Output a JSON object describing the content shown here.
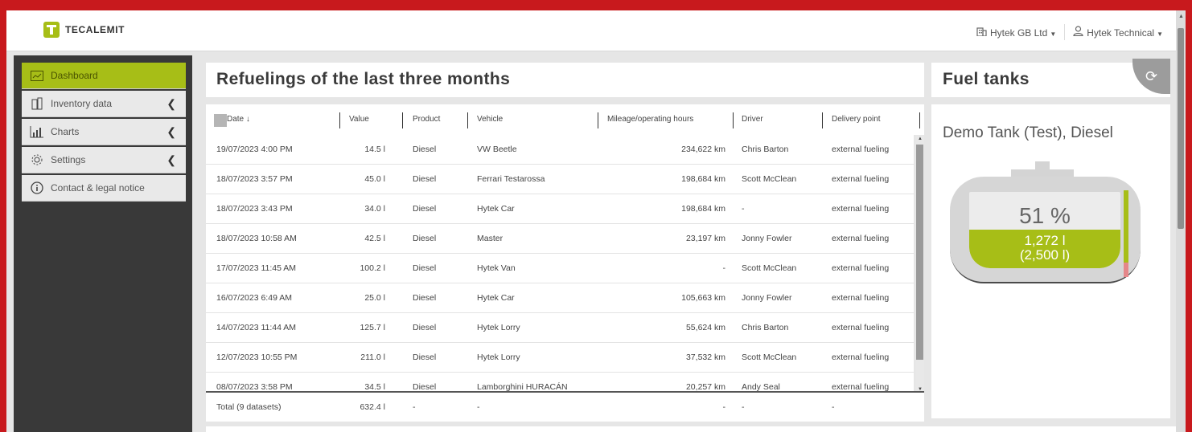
{
  "app": {
    "brand": "TECALEMIT",
    "company_menu": "Hytek GB Ltd",
    "user_menu": "Hytek Technical"
  },
  "sidebar": {
    "items": [
      {
        "label": "Dashboard",
        "icon": "dashboard-icon",
        "active": true
      },
      {
        "label": "Inventory data",
        "icon": "inventory-icon",
        "active": false
      },
      {
        "label": "Charts",
        "icon": "chart-icon",
        "active": false
      },
      {
        "label": "Settings",
        "icon": "gear-icon",
        "active": false
      },
      {
        "label": "Contact & legal notice",
        "icon": "info-icon",
        "active": false
      }
    ]
  },
  "refuelings": {
    "title": "Refuelings of the last three months",
    "columns": [
      "Date",
      "Value",
      "Product",
      "Vehicle",
      "Mileage/operating hours",
      "Driver",
      "Delivery point"
    ],
    "rows": [
      {
        "date": "19/07/2023 4:00 PM",
        "value": "14.5 l",
        "product": "Diesel",
        "vehicle": "VW Beetle",
        "mileage": "234,622 km",
        "driver": "Chris Barton",
        "delivery": "external fueling"
      },
      {
        "date": "18/07/2023 3:57 PM",
        "value": "45.0 l",
        "product": "Diesel",
        "vehicle": "Ferrari Testarossa",
        "mileage": "198,684 km",
        "driver": "Scott McClean",
        "delivery": "external fueling"
      },
      {
        "date": "18/07/2023 3:43 PM",
        "value": "34.0 l",
        "product": "Diesel",
        "vehicle": "Hytek Car",
        "mileage": "198,684 km",
        "driver": "-",
        "delivery": "external fueling"
      },
      {
        "date": "18/07/2023 10:58 AM",
        "value": "42.5 l",
        "product": "Diesel",
        "vehicle": "Master",
        "mileage": "23,197 km",
        "driver": "Jonny Fowler",
        "delivery": "external fueling"
      },
      {
        "date": "17/07/2023 11:45 AM",
        "value": "100.2 l",
        "product": "Diesel",
        "vehicle": "Hytek Van",
        "mileage": "-",
        "driver": "Scott McClean",
        "delivery": "external fueling"
      },
      {
        "date": "16/07/2023 6:49 AM",
        "value": "25.0 l",
        "product": "Diesel",
        "vehicle": "Hytek Car",
        "mileage": "105,663 km",
        "driver": "Jonny Fowler",
        "delivery": "external fueling"
      },
      {
        "date": "14/07/2023 11:44 AM",
        "value": "125.7 l",
        "product": "Diesel",
        "vehicle": "Hytek Lorry",
        "mileage": "55,624 km",
        "driver": "Chris Barton",
        "delivery": "external fueling"
      },
      {
        "date": "12/07/2023 10:55 PM",
        "value": "211.0 l",
        "product": "Diesel",
        "vehicle": "Hytek Lorry",
        "mileage": "37,532 km",
        "driver": "Scott McClean",
        "delivery": "external fueling"
      },
      {
        "date": "08/07/2023 3:58 PM",
        "value": "34.5 l",
        "product": "Diesel",
        "vehicle": "Lamborghini HURACÁN",
        "mileage": "20,257 km",
        "driver": "Andy Seal",
        "delivery": "external fueling"
      }
    ],
    "total": {
      "label": "Total (9 datasets)",
      "value": "632.4 l",
      "product": "-",
      "vehicle": "-",
      "mileage": "-",
      "driver": "-",
      "delivery": "-"
    }
  },
  "fuel_tanks": {
    "title": "Fuel tanks",
    "tank": {
      "name": "Demo Tank (Test), Diesel",
      "percent_label": "51 %",
      "fill_fraction": 0.51,
      "volume": "1,272 l",
      "capacity": "(2,500 l)"
    }
  },
  "colors": {
    "accent": "#a7be17",
    "sidebar_bg": "#393939",
    "frame_border": "#c8191d",
    "low_level": "#e5878a"
  }
}
